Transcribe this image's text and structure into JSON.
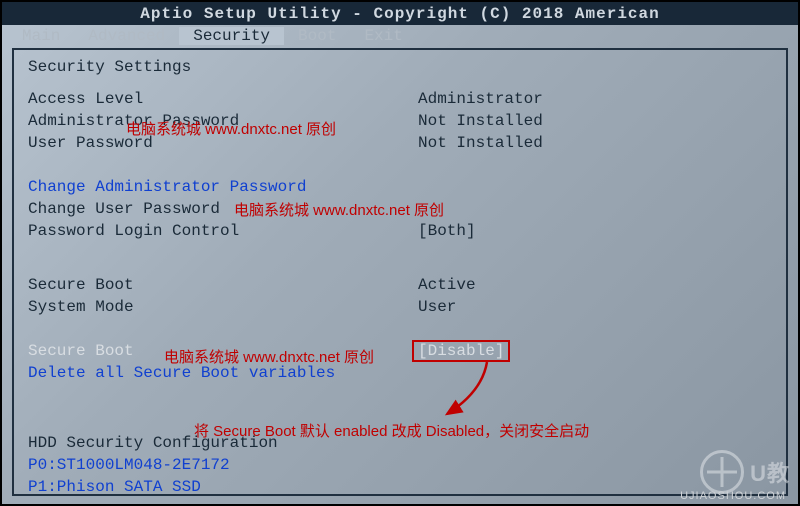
{
  "title": "Aptio Setup Utility - Copyright (C) 2018 American",
  "menus": {
    "main": "Main",
    "advanced": "Advanced",
    "security": "Security",
    "boot": "Boot",
    "exit": "Exit"
  },
  "section_title": "Security Settings",
  "rows": {
    "access_level": {
      "label": "Access Level",
      "value": "Administrator"
    },
    "admin_pw": {
      "label": "Administrator Password",
      "value": "Not Installed"
    },
    "user_pw": {
      "label": "User Password",
      "value": "Not Installed"
    },
    "change_admin": {
      "label": "Change Administrator Password"
    },
    "change_user": {
      "label": "Change User Password"
    },
    "pw_login": {
      "label": "Password Login Control",
      "value": "[Both]"
    },
    "secure_boot_status": {
      "label": "Secure Boot",
      "value": "Active"
    },
    "system_mode": {
      "label": "System Mode",
      "value": "User"
    },
    "secure_boot": {
      "label": "Secure Boot",
      "value": "[Disable]"
    },
    "delete_sb": {
      "label": "Delete all Secure Boot variables"
    },
    "hdd_sec": {
      "label": "HDD Security Configuration"
    },
    "hdd0": {
      "label": "P0:ST1000LM048-2E7172"
    },
    "hdd1": {
      "label": "P1:Phison SATA SSD"
    }
  },
  "annotations": {
    "watermark1": "电脑系统城 www.dnxtc.net 原创",
    "watermark2": "电脑系统城 www.dnxtc.net 原创",
    "watermark3": "电脑系统城 www.dnxtc.net 原创",
    "instruction": "将 Secure Boot 默认 enabled 改成 Disabled，关闭安全启动"
  },
  "page_watermark": {
    "brand": "U教",
    "site": "UJIAOSHOU.COM"
  }
}
